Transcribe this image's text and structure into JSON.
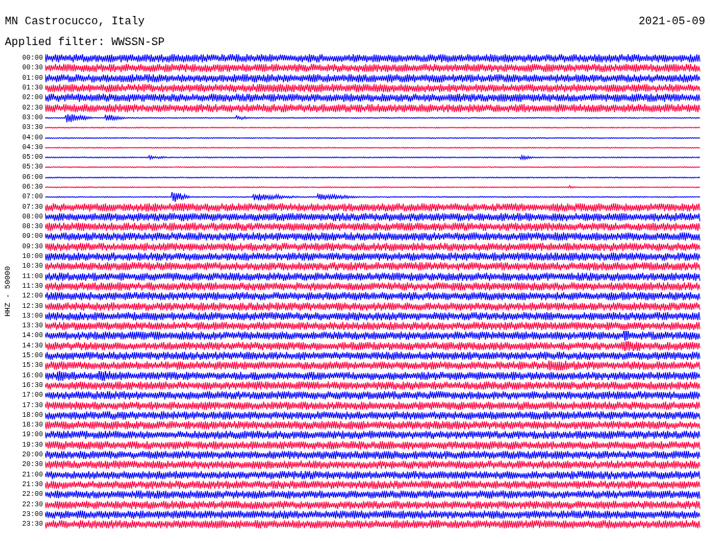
{
  "header": {
    "station": "MN Castrocucco, Italy",
    "date": "2021-05-09",
    "filter": "Applied filter: WWSSN-SP"
  },
  "plot": {
    "channel_label": "HHZ - 50000",
    "rows": [
      {
        "time": "00:00",
        "color": "#0000ff",
        "kind": "band"
      },
      {
        "time": "00:30",
        "color": "#ff0040",
        "kind": "band"
      },
      {
        "time": "01:00",
        "color": "#0000ff",
        "kind": "band"
      },
      {
        "time": "01:30",
        "color": "#ff0040",
        "kind": "band"
      },
      {
        "time": "02:00",
        "color": "#0000ff",
        "kind": "band"
      },
      {
        "time": "02:30",
        "color": "#ff0040",
        "kind": "band"
      },
      {
        "time": "03:00",
        "color": "#0000ff",
        "kind": "line"
      },
      {
        "time": "03:30",
        "color": "#ff0040",
        "kind": "line"
      },
      {
        "time": "04:00",
        "color": "#0000ff",
        "kind": "line"
      },
      {
        "time": "04:30",
        "color": "#ff0040",
        "kind": "line"
      },
      {
        "time": "05:00",
        "color": "#0000ff",
        "kind": "line"
      },
      {
        "time": "05:30",
        "color": "#ff0040",
        "kind": "line"
      },
      {
        "time": "06:00",
        "color": "#0000ff",
        "kind": "line"
      },
      {
        "time": "06:30",
        "color": "#ff0040",
        "kind": "line"
      },
      {
        "time": "07:00",
        "color": "#0000ff",
        "kind": "line"
      },
      {
        "time": "07:30",
        "color": "#ff0040",
        "kind": "band"
      },
      {
        "time": "08:00",
        "color": "#0000ff",
        "kind": "band"
      },
      {
        "time": "08:30",
        "color": "#ff0040",
        "kind": "band"
      },
      {
        "time": "09:00",
        "color": "#0000ff",
        "kind": "band"
      },
      {
        "time": "09:30",
        "color": "#ff0040",
        "kind": "band"
      },
      {
        "time": "10:00",
        "color": "#0000ff",
        "kind": "band"
      },
      {
        "time": "10:30",
        "color": "#ff0040",
        "kind": "band"
      },
      {
        "time": "11:00",
        "color": "#0000ff",
        "kind": "band"
      },
      {
        "time": "11:30",
        "color": "#ff0040",
        "kind": "band"
      },
      {
        "time": "12:00",
        "color": "#0000ff",
        "kind": "band"
      },
      {
        "time": "12:30",
        "color": "#ff0040",
        "kind": "band"
      },
      {
        "time": "13:00",
        "color": "#0000ff",
        "kind": "band"
      },
      {
        "time": "13:30",
        "color": "#ff0040",
        "kind": "band"
      },
      {
        "time": "14:00",
        "color": "#0000ff",
        "kind": "band"
      },
      {
        "time": "14:30",
        "color": "#ff0040",
        "kind": "band"
      },
      {
        "time": "15:00",
        "color": "#0000ff",
        "kind": "band"
      },
      {
        "time": "15:30",
        "color": "#ff0040",
        "kind": "band"
      },
      {
        "time": "16:00",
        "color": "#0000ff",
        "kind": "band"
      },
      {
        "time": "16:30",
        "color": "#ff0040",
        "kind": "band"
      },
      {
        "time": "17:00",
        "color": "#0000ff",
        "kind": "band"
      },
      {
        "time": "17:30",
        "color": "#ff0040",
        "kind": "band"
      },
      {
        "time": "18:00",
        "color": "#0000ff",
        "kind": "band"
      },
      {
        "time": "18:30",
        "color": "#ff0040",
        "kind": "band"
      },
      {
        "time": "19:00",
        "color": "#0000ff",
        "kind": "band"
      },
      {
        "time": "19:30",
        "color": "#ff0040",
        "kind": "band"
      },
      {
        "time": "20:00",
        "color": "#0000ff",
        "kind": "band"
      },
      {
        "time": "20:30",
        "color": "#ff0040",
        "kind": "band"
      },
      {
        "time": "21:00",
        "color": "#0000ff",
        "kind": "band"
      },
      {
        "time": "21:30",
        "color": "#ff0040",
        "kind": "band"
      },
      {
        "time": "22:00",
        "color": "#0000ff",
        "kind": "band"
      },
      {
        "time": "22:30",
        "color": "#ff0040",
        "kind": "band"
      },
      {
        "time": "23:00",
        "color": "#0000ff",
        "kind": "band"
      },
      {
        "time": "23:30",
        "color": "#ff0040",
        "kind": "band"
      }
    ]
  }
}
